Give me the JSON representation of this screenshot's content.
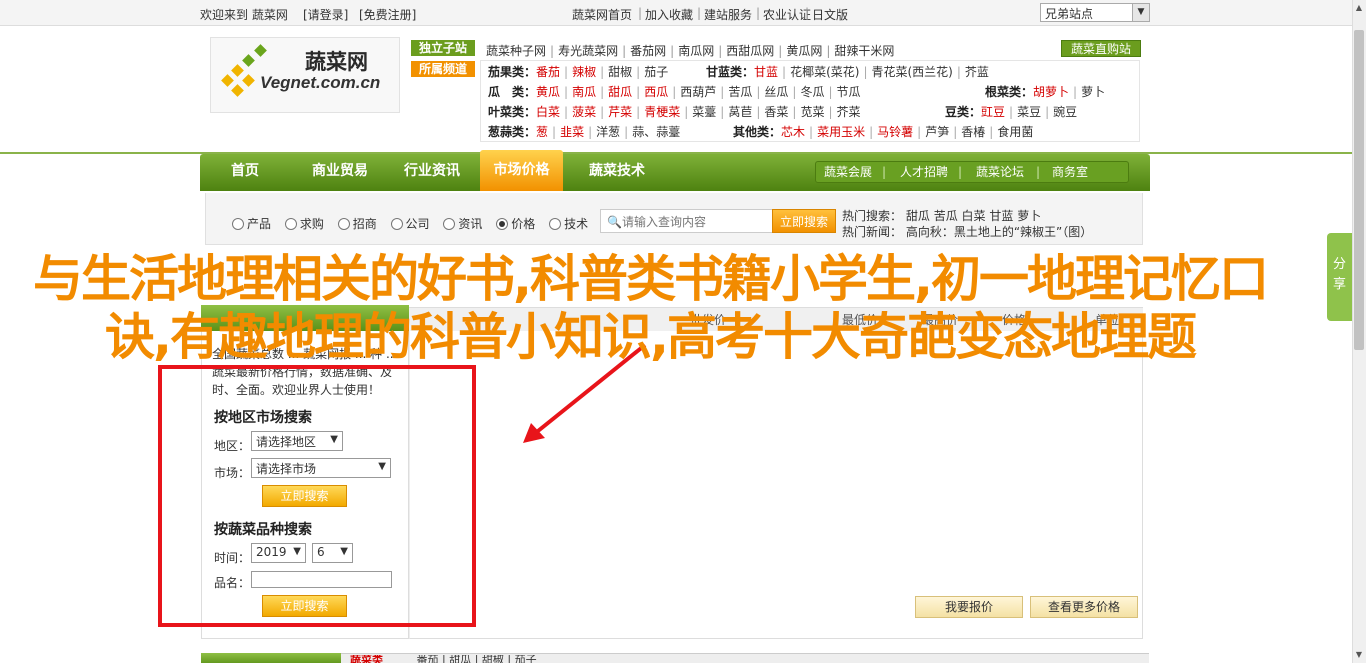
{
  "topbar": {
    "left": [
      "欢迎来到 蔬菜网",
      "[请登录]",
      "[免费注册]"
    ],
    "right": [
      "蔬菜网首页",
      "加入收藏",
      "建站服务",
      "农业认证",
      "日文版"
    ],
    "site_select": "兄弟站点"
  },
  "logo": {
    "title": "蔬菜网",
    "sub": "Vegnet.com.cn"
  },
  "header": {
    "tag_indep": "独立子站",
    "tag_sub": "所属频道",
    "direct_btn": "蔬菜直购站",
    "indep_sites": [
      "蔬菜种子网",
      "寿光蔬菜网",
      "番茄网",
      "南瓜网",
      "西甜瓜网",
      "黄瓜网",
      "甜辣干米网"
    ],
    "rows": [
      {
        "label": "茄果类：",
        "items": [
          {
            "t": "番茄",
            "r": true
          },
          {
            "t": "辣椒",
            "r": true
          },
          {
            "t": "甜椒",
            "r": false
          },
          {
            "t": "茄子",
            "r": false
          }
        ],
        "label2": "甘蓝类：",
        "items2": [
          {
            "t": "甘蓝",
            "r": true
          },
          {
            "t": "花椰菜(菜花)",
            "r": false
          },
          {
            "t": "青花菜(西兰花)",
            "r": false
          },
          {
            "t": "芥蓝",
            "r": false
          }
        ]
      },
      {
        "label": "瓜　类：",
        "items": [
          {
            "t": "黄瓜",
            "r": true
          },
          {
            "t": "南瓜",
            "r": true
          },
          {
            "t": "甜瓜",
            "r": true
          },
          {
            "t": "西瓜",
            "r": true
          },
          {
            "t": "西葫芦",
            "r": false
          },
          {
            "t": "苦瓜",
            "r": false
          },
          {
            "t": "丝瓜",
            "r": false
          },
          {
            "t": "冬瓜",
            "r": false
          },
          {
            "t": "节瓜",
            "r": false
          }
        ],
        "label2": "根菜类：",
        "items2": [
          {
            "t": "胡萝卜",
            "r": true
          },
          {
            "t": "萝卜",
            "r": false
          }
        ]
      },
      {
        "label": "叶菜类：",
        "items": [
          {
            "t": "白菜",
            "r": true
          },
          {
            "t": "菠菜",
            "r": true
          },
          {
            "t": "芹菜",
            "r": true
          },
          {
            "t": "青梗菜",
            "r": true
          },
          {
            "t": "菜薹",
            "r": false
          },
          {
            "t": "莴苣",
            "r": false
          },
          {
            "t": "香菜",
            "r": false
          },
          {
            "t": "苋菜",
            "r": false
          },
          {
            "t": "芥菜",
            "r": false
          }
        ],
        "label2": "豆类：",
        "items2": [
          {
            "t": "豇豆",
            "r": true
          },
          {
            "t": "菜豆",
            "r": false
          },
          {
            "t": "豌豆",
            "r": false
          }
        ]
      },
      {
        "label": "葱蒜类：",
        "items": [
          {
            "t": "葱",
            "r": true
          },
          {
            "t": "韭菜",
            "r": true
          },
          {
            "t": "洋葱",
            "r": false
          },
          {
            "t": "蒜、蒜薹",
            "r": false
          }
        ],
        "label2": "其他类：",
        "items2": [
          {
            "t": "芯木",
            "r": true
          },
          {
            "t": "菜用玉米",
            "r": true
          },
          {
            "t": "马铃薯",
            "r": true
          },
          {
            "t": "芦笋",
            "r": false
          },
          {
            "t": "香椿",
            "r": false
          },
          {
            "t": "食用菌",
            "r": false
          }
        ]
      }
    ]
  },
  "nav": {
    "items": [
      "首页",
      "商业贸易",
      "行业资讯",
      "市场价格",
      "蔬菜技术"
    ],
    "sub_items": [
      "蔬菜会展",
      "人才招聘",
      "蔬菜论坛",
      "商务室"
    ]
  },
  "search": {
    "options": [
      "产品",
      "求购",
      "招商",
      "公司",
      "资讯",
      "价格",
      "技术"
    ],
    "selected": "价格",
    "placeholder": "请输入查询内容",
    "button": "立即搜索",
    "hot_label": "热门搜索：",
    "hot_items": [
      "甜瓜",
      "苦瓜",
      "白菜",
      "甘蓝",
      "萝卜"
    ],
    "news_label": "热门新闻：",
    "news_text": "高向秋：黑土地上的“辣椒王”（图）"
  },
  "left_panel": {
    "intro": "全国蔬菜总数 ... 蔬菜网报 ... 种 ... 蔬菜最新价格行情，数据准确、及时、全面。欢迎业界人士使用！",
    "region_title": "按地区市场搜索",
    "region_label": "地区：",
    "region_value": "请选择地区",
    "market_label": "市场：",
    "market_value": "请选择市场",
    "button": "立即搜索",
    "variety_title": "按蔬菜品种搜索",
    "time_label": "时间：",
    "year": "2019",
    "month": "6",
    "name_label": "品名：",
    "button2": "立即搜索"
  },
  "table": {
    "headers": [
      "批发价",
      "最低价",
      "最高价",
      "价格",
      "单位"
    ]
  },
  "price_buttons": [
    "我要报价",
    "查看更多价格"
  ],
  "bottom": {
    "tag": "蔬菜类",
    "items": [
      "番茄",
      "甜瓜",
      "甜椒",
      "茄子"
    ]
  },
  "share_tab": "分享",
  "overlay": {
    "title": "与生活地理相关的好书,科普类书籍小学生,初一地理记忆口诀,有趣地理的科普小知识,高考十大奇葩变态地理题",
    "accent": "#f28b00",
    "box_color": "#e8141a"
  }
}
